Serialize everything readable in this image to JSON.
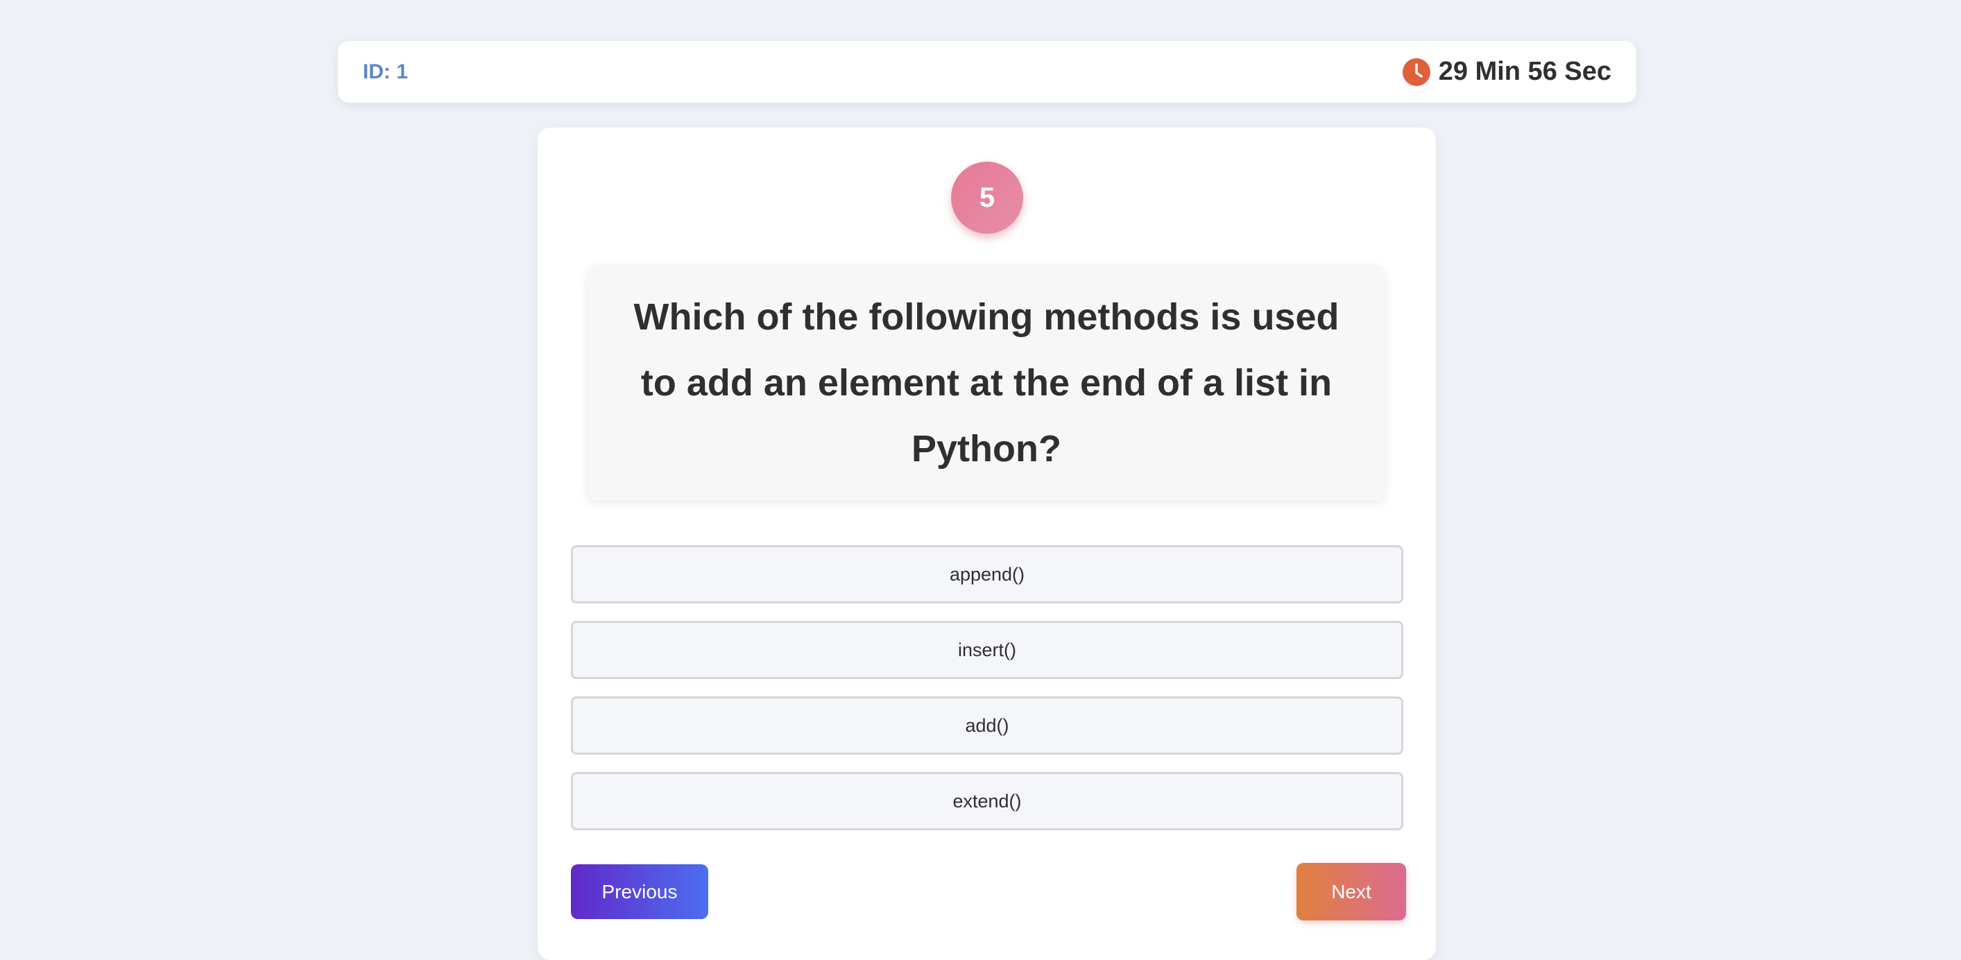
{
  "header": {
    "id_label": "ID: 1",
    "timer_text": "29 Min 56 Sec",
    "timer_icon": "clock-icon"
  },
  "question": {
    "number": "5",
    "text": "Which of the following methods is used to add an element at the end of a list in Python?"
  },
  "options": [
    {
      "label": "append()"
    },
    {
      "label": "insert()"
    },
    {
      "label": "add()"
    },
    {
      "label": "extend()"
    }
  ],
  "navigation": {
    "previous_label": "Previous",
    "next_label": "Next"
  },
  "colors": {
    "page_background": "#eef1f6",
    "id_text": "#5f86c9",
    "timer_icon": "#e0603a",
    "question_badge": "#e77997",
    "previous_gradient": [
      "#6229c9",
      "#4d6ef0"
    ],
    "next_gradient": [
      "#e0803e",
      "#dc6b92"
    ]
  }
}
